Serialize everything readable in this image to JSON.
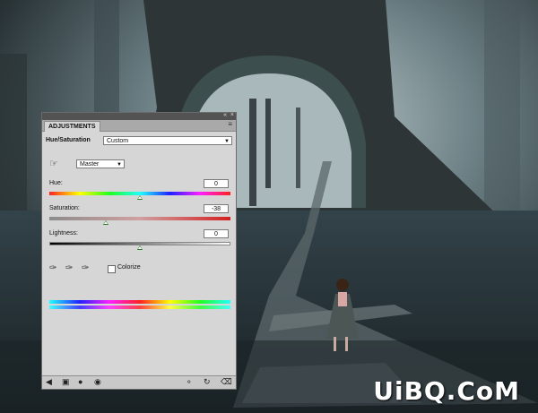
{
  "panel": {
    "tab_label": "ADJUSTMENTS",
    "adjustment_title": "Hue/Saturation",
    "preset_value": "Custom",
    "channel_value": "Master",
    "colorize_label": "Colorize"
  },
  "sliders": {
    "hue": {
      "label": "Hue:",
      "value": "0",
      "level": 0.5
    },
    "saturation": {
      "label": "Saturation:",
      "value": "-38",
      "level": 0.31
    },
    "lightness": {
      "label": "Lightness:",
      "value": "0",
      "level": 0.5
    }
  },
  "watermark": {
    "text": "UiBQ.CoM"
  }
}
